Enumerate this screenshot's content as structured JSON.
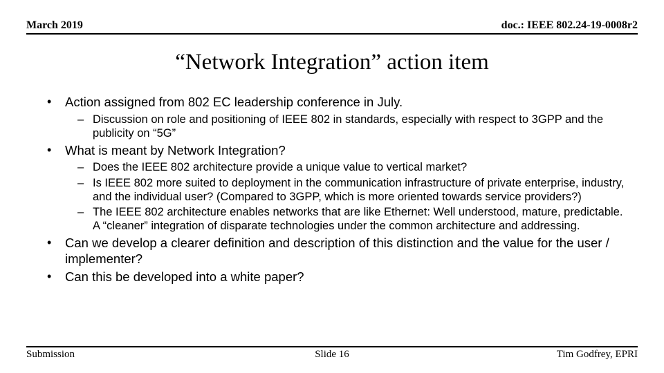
{
  "header": {
    "date": "March 2019",
    "doc": "doc.: IEEE 802.24-19-0008r2"
  },
  "title": "“Network Integration” action item",
  "bullets": [
    {
      "text": "Action assigned from 802 EC leadership conference in July.",
      "sub": [
        "Discussion on role and positioning of IEEE 802 in standards, especially with respect to 3GPP and the publicity on “5G”"
      ]
    },
    {
      "text": "What is meant by Network Integration?",
      "sub": [
        "Does the IEEE 802 architecture provide a unique value to vertical market?",
        "Is IEEE 802 more suited to deployment in the communication infrastructure of private enterprise, industry, and the individual user? (Compared to 3GPP, which is more oriented towards service providers?)",
        "The IEEE 802 architecture enables networks that are like Ethernet: Well understood, mature, predictable. A “cleaner” integration of disparate technologies under the common architecture and addressing."
      ]
    },
    {
      "text": "Can we develop a clearer definition and description of this distinction and the value for the user / implementer?",
      "sub": []
    },
    {
      "text": "Can this be developed into a white paper?",
      "sub": []
    }
  ],
  "footer": {
    "left": "Submission",
    "center": "Slide 16",
    "right": "Tim Godfrey, EPRI"
  }
}
